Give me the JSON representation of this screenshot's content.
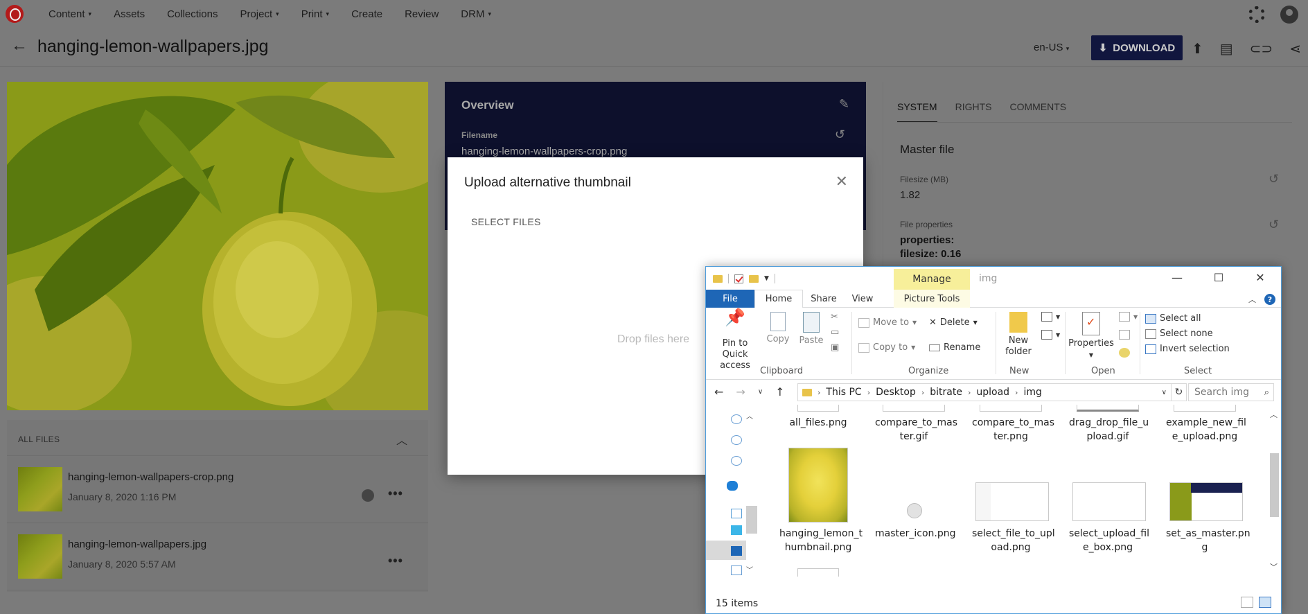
{
  "nav": {
    "items": [
      "Content",
      "Assets",
      "Collections",
      "Project",
      "Print",
      "Create",
      "Review",
      "DRM"
    ],
    "caret_items": [
      0,
      3,
      4,
      7
    ],
    "caret": "▾"
  },
  "header": {
    "title": "hanging-lemon-wallpapers.jpg",
    "locale": "en-US",
    "download_label": "DOWNLOAD"
  },
  "all_files": {
    "heading": "ALL FILES",
    "files": [
      {
        "name": "hanging-lemon-wallpapers-crop.png",
        "date": "January 8, 2020 1:16 PM"
      },
      {
        "name": "hanging-lemon-wallpapers.jpg",
        "date": "January 8, 2020 5:57 AM"
      }
    ]
  },
  "overview": {
    "title": "Overview",
    "filename_label": "Filename",
    "filename_value": "hanging-lemon-wallpapers-crop.png"
  },
  "side": {
    "tabs": [
      "SYSTEM",
      "RIGHTS",
      "COMMENTS"
    ],
    "heading": "Master file",
    "filesize_label": "Filesize (MB)",
    "filesize_value": "1.82",
    "props_label": "File properties",
    "props_key": "properties:",
    "props_filesize": "filesize: 0.16"
  },
  "modal": {
    "title": "Upload alternative thumbnail",
    "select_files": "SELECT FILES",
    "drop_text": "Drop files here"
  },
  "explorer": {
    "manage": "Manage",
    "window_title": "img",
    "ribbon_tabs": {
      "file": "File",
      "home": "Home",
      "share": "Share",
      "view": "View",
      "picture_tools": "Picture Tools"
    },
    "clipboard": {
      "pin": "Pin to Quick access",
      "copy": "Copy",
      "paste": "Paste",
      "label": "Clipboard"
    },
    "organize": {
      "move_to": "Move to",
      "copy_to": "Copy to",
      "delete": "Delete",
      "rename": "Rename",
      "label": "Organize"
    },
    "new": {
      "new_folder": "New folder",
      "label": "New"
    },
    "open": {
      "properties": "Properties",
      "label": "Open"
    },
    "select": {
      "select_all": "Select all",
      "select_none": "Select none",
      "invert": "Invert selection",
      "label": "Select"
    },
    "address": [
      "This PC",
      "Desktop",
      "bitrate",
      "upload",
      "img"
    ],
    "search_placeholder": "Search img",
    "files_row1": [
      "all_files.png",
      "compare_to_mas\nter.gif",
      "compare_to_mas\nter.png",
      "drag_drop_file_u\npload.gif",
      "example_new_fil\ne_upload.png"
    ],
    "files_row2": [
      "hanging_lemon_t\nhumbnail.png",
      "master_icon.png",
      "select_file_to_upl\noad.png",
      "select_upload_fil\ne_box.png",
      "set_as_master.pn\ng"
    ],
    "item_count": "15 items"
  }
}
